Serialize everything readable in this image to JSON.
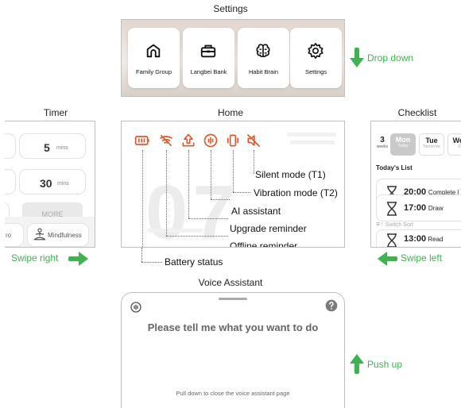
{
  "titles": {
    "settings": "Settings",
    "timer": "Timer",
    "home": "Home",
    "checklist": "Checklist",
    "voice": "Voice Assistant"
  },
  "settings_tiles": [
    {
      "label": "Family Group",
      "icon": "home-icon"
    },
    {
      "label": "Langbei Bank",
      "icon": "bank-icon"
    },
    {
      "label": "Habit Brain",
      "icon": "brain-icon"
    },
    {
      "label": "Settings",
      "icon": "gear-icon"
    }
  ],
  "gestures": {
    "drop_down": "Drop down",
    "swipe_right": "Swipe right",
    "swipe_left": "Swipe left",
    "push_up": "Push up"
  },
  "timer": {
    "val1": "5",
    "unit1": "mins",
    "val2": "30",
    "unit2": "mins",
    "more": "MORE",
    "left_cut": "ro",
    "mindfulness": "Mindfulness"
  },
  "home": {
    "big_clock": "07 30",
    "annotations": {
      "silent": "Silent mode (T1)",
      "vibration": "Vibration mode (T2)",
      "ai": "AI assistant",
      "upgrade": "Upgrade reminder",
      "offline": "Offline reminder",
      "battery": "Battery status"
    },
    "accent": "#e8552a"
  },
  "checklist": {
    "weeks_num": "3",
    "weeks_label": "weeks",
    "days": [
      {
        "name": "Mon",
        "sub": "Today"
      },
      {
        "name": "Tue",
        "sub": "Tomorrow"
      },
      {
        "name": "Wed",
        "sub": "01"
      }
    ],
    "list_title": "Today's List",
    "tasks": [
      {
        "time": "20:00",
        "name": "Complete l"
      },
      {
        "time": "17:00",
        "name": "Draw"
      },
      {
        "time": "13:00",
        "name": "Read"
      }
    ],
    "switch_sort": "Switch Sort"
  },
  "voice": {
    "prompt": "Please tell me what you want to do",
    "close_hint": "Pull down to close the voice assistant page"
  },
  "colors": {
    "green": "#3fb34f",
    "orange": "#e8552a",
    "selected_day": "#c9c9c9"
  }
}
